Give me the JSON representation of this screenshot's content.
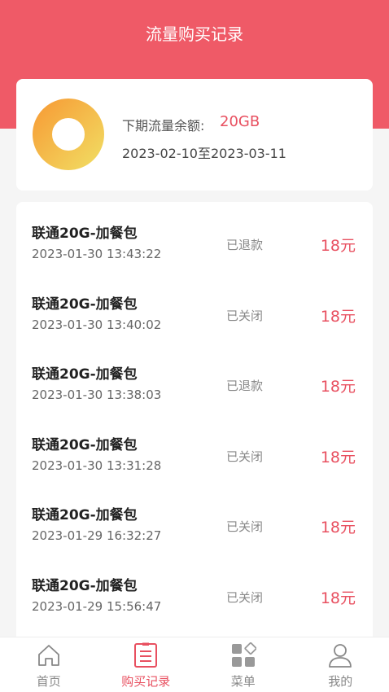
{
  "header": {
    "title": "流量购买记录"
  },
  "summary": {
    "label": "下期流量余额:",
    "value": "20GB",
    "period": "2023-02-10至2023-03-11"
  },
  "records": [
    {
      "title": "联通20G-加餐包",
      "time": "2023-01-30 13:43:22",
      "status": "已退款",
      "price": "18元"
    },
    {
      "title": "联通20G-加餐包",
      "time": "2023-01-30 13:40:02",
      "status": "已关闭",
      "price": "18元"
    },
    {
      "title": "联通20G-加餐包",
      "time": "2023-01-30 13:38:03",
      "status": "已退款",
      "price": "18元"
    },
    {
      "title": "联通20G-加餐包",
      "time": "2023-01-30 13:31:28",
      "status": "已关闭",
      "price": "18元"
    },
    {
      "title": "联通20G-加餐包",
      "time": "2023-01-29 16:32:27",
      "status": "已关闭",
      "price": "18元"
    },
    {
      "title": "联通20G-加餐包",
      "time": "2023-01-29 15:56:47",
      "status": "已关闭",
      "price": "18元"
    }
  ],
  "tabs": [
    {
      "label": "首页",
      "icon": "home-icon"
    },
    {
      "label": "购买记录",
      "icon": "document-list-icon",
      "active": true
    },
    {
      "label": "菜单",
      "icon": "grid-menu-icon"
    },
    {
      "label": "我的",
      "icon": "user-icon"
    }
  ],
  "colors": {
    "brand": "#ef5a67",
    "accent": "#e85060",
    "donut_start": "#f6a23a",
    "donut_end": "#f2d65e"
  }
}
